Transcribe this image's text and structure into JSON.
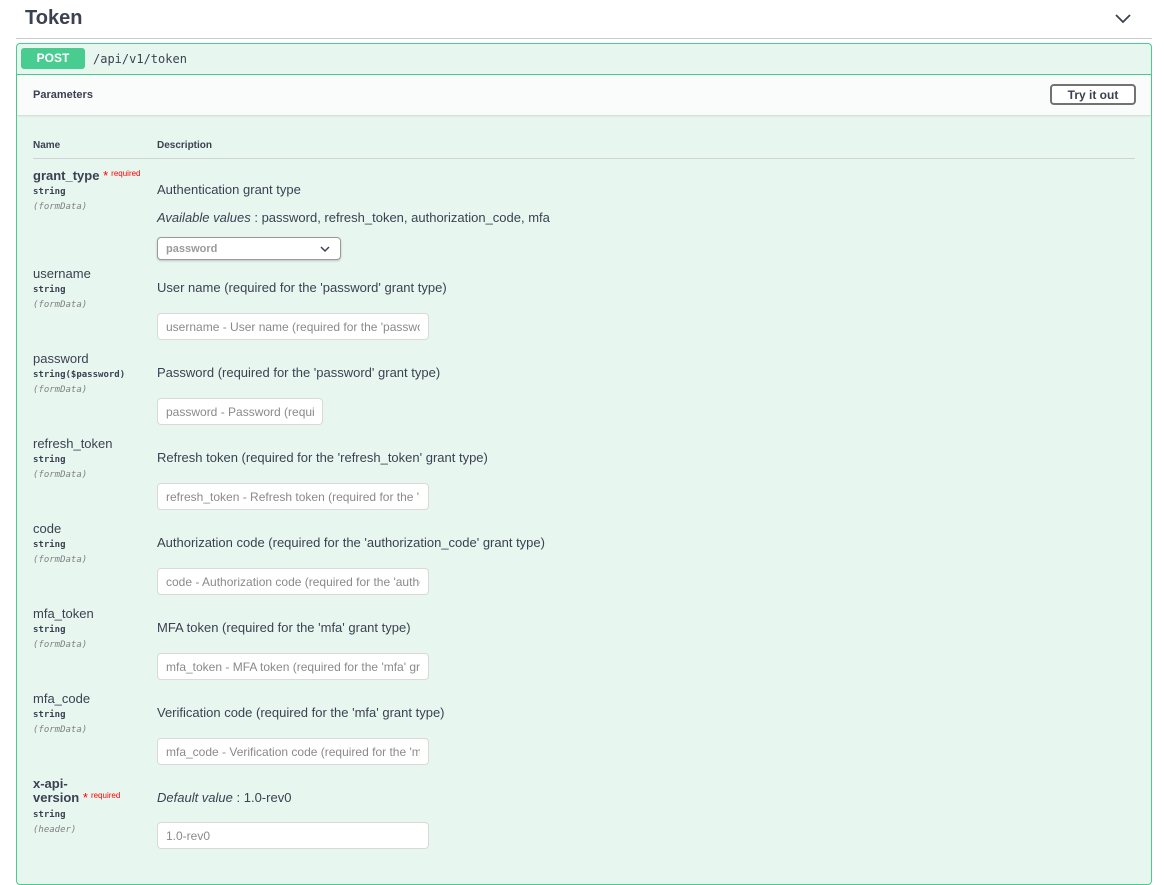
{
  "tag": {
    "title": "Token",
    "toggle_icon": "chevron-down-icon"
  },
  "operation": {
    "method": "POST",
    "path": "/api/v1/token"
  },
  "parameters": {
    "section_title": "Parameters",
    "try_button": "Try it out",
    "col_name": "Name",
    "col_description": "Description",
    "available_values_label": "Available values",
    "default_value_label": "Default value",
    "required_label": "required",
    "items": [
      {
        "name": "grant_type",
        "required": true,
        "type": "string",
        "in": "(formData)",
        "description": "Authentication grant type",
        "available_values": "password, refresh_token, authorization_code, mfa",
        "selected": "password"
      },
      {
        "name": "username",
        "type": "string",
        "in": "(formData)",
        "description": "User name (required for the 'password' grant type)",
        "placeholder": "username - User name (required for the 'password' grant type)"
      },
      {
        "name": "password",
        "type": "string($password)",
        "in": "(formData)",
        "description": "Password (required for the 'password' grant type)",
        "placeholder": "password - Password (required for the 'password' grant type)"
      },
      {
        "name": "refresh_token",
        "type": "string",
        "in": "(formData)",
        "description": "Refresh token (required for the 'refresh_token' grant type)",
        "placeholder": "refresh_token - Refresh token (required for the 'refresh_token' grant type)"
      },
      {
        "name": "code",
        "type": "string",
        "in": "(formData)",
        "description": "Authorization code (required for the 'authorization_code' grant type)",
        "placeholder": "code - Authorization code (required for the 'authorization_code' grant type)"
      },
      {
        "name": "mfa_token",
        "type": "string",
        "in": "(formData)",
        "description": "MFA token (required for the 'mfa' grant type)",
        "placeholder": "mfa_token - MFA token (required for the 'mfa' grant type)"
      },
      {
        "name": "mfa_code",
        "type": "string",
        "in": "(formData)",
        "description": "Verification code (required for the 'mfa' grant type)",
        "placeholder": "mfa_code - Verification code (required for the 'mfa' grant type)"
      },
      {
        "name_line1": "x-api-",
        "name_line2": "version",
        "required": true,
        "type": "string",
        "in": "(header)",
        "default_value": "1.0-rev0",
        "value": "1.0-rev0"
      }
    ]
  }
}
